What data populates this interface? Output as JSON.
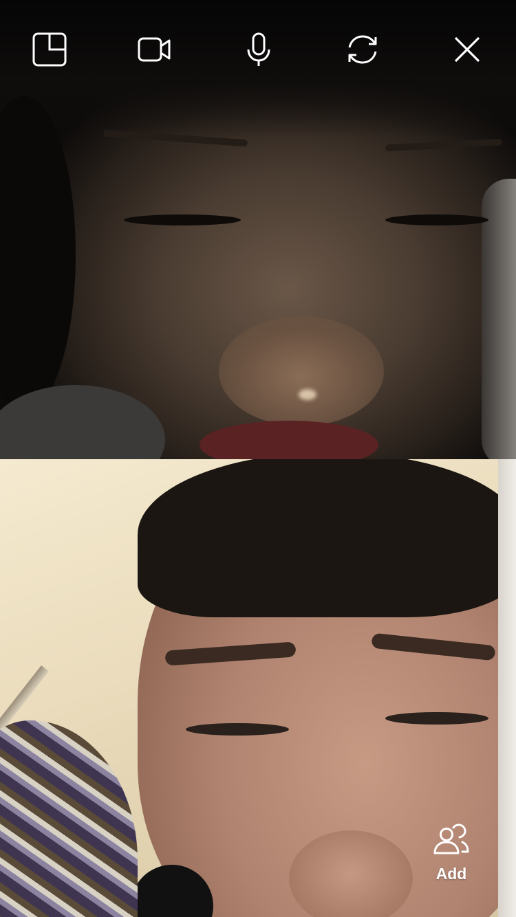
{
  "toolbar": {
    "items": [
      {
        "name": "picture-in-picture-icon",
        "kind": "pip"
      },
      {
        "name": "video-camera-icon",
        "kind": "camera"
      },
      {
        "name": "microphone-icon",
        "kind": "mic"
      },
      {
        "name": "flip-camera-icon",
        "kind": "flip"
      },
      {
        "name": "close-icon",
        "kind": "close"
      }
    ],
    "icon_color": "#ffffff"
  },
  "participants": {
    "add_label": "Add",
    "add_icon": "people-add-icon"
  }
}
